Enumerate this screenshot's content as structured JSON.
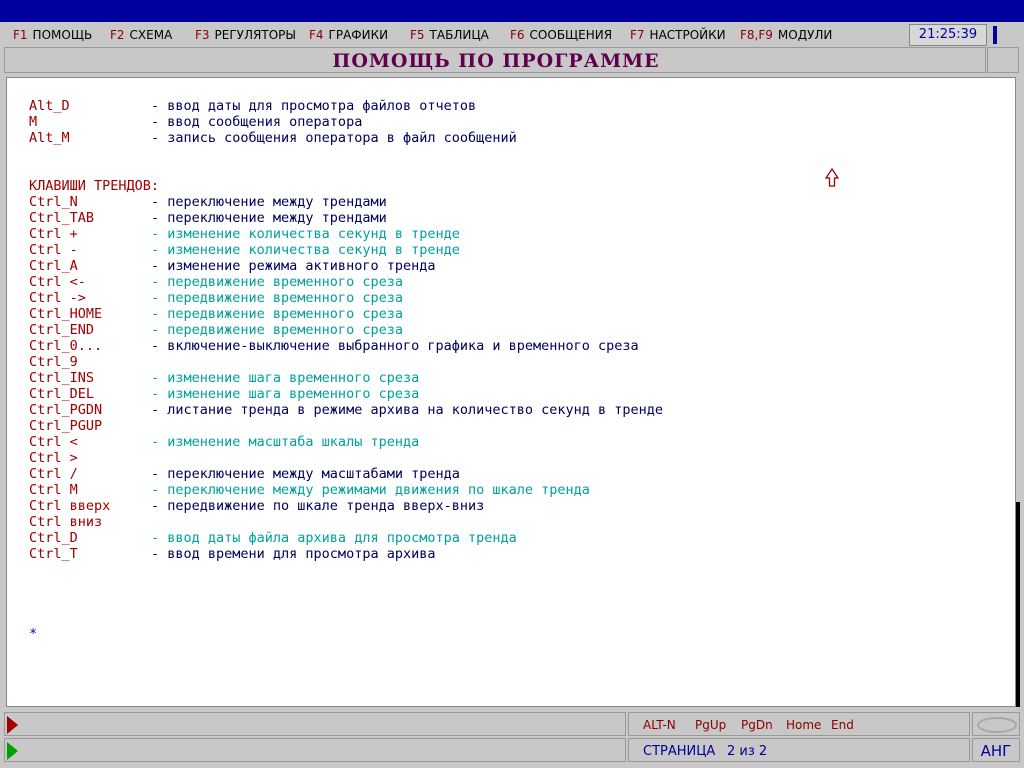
{
  "clock": "21:25:39",
  "menu": [
    {
      "key": "F1",
      "label": "ПОМОЩЬ"
    },
    {
      "key": "F2",
      "label": "СХЕМА"
    },
    {
      "key": "F3",
      "label": "РЕГУЛЯТОРЫ"
    },
    {
      "key": "F4",
      "label": "ГРАФИКИ"
    },
    {
      "key": "F5",
      "label": "ТАБЛИЦА"
    },
    {
      "key": "F6",
      "label": "СООБЩЕНИЯ"
    },
    {
      "key": "F7",
      "label": "НАСТРОЙКИ"
    },
    {
      "key": "F8,F9",
      "label": "МОДУЛИ"
    }
  ],
  "title": "ПОМОЩЬ  ПО  ПРОГРАММЕ",
  "lines": [
    {
      "key": "Alt_D",
      "desc": "- ввод даты для просмотра файлов отчетов",
      "style": "navy"
    },
    {
      "key": "M",
      "desc": "- ввод сообщения оператора",
      "style": "navy"
    },
    {
      "key": "Alt_M",
      "desc": "- запись сообщения оператора в файл сообщений",
      "style": "navy"
    },
    {
      "section": "КЛАВИШИ ТРЕНДОВ:"
    },
    {
      "key": "Ctrl_N",
      "desc": "- переключение между трендами",
      "style": "navy"
    },
    {
      "key": "Ctrl_TAB",
      "desc": "- переключение между трендами",
      "style": "navy"
    },
    {
      "key": "Ctrl +",
      "desc": "- изменение количества секунд в тренде",
      "style": "teal"
    },
    {
      "key": "Ctrl -",
      "desc": "- изменение количества секунд в тренде",
      "style": "teal"
    },
    {
      "key": "Ctrl_A",
      "desc": "- изменение режима активного тренда",
      "style": "navy"
    },
    {
      "key": "Ctrl <-",
      "desc": "- передвижение временного среза",
      "style": "teal"
    },
    {
      "key": "Ctrl ->",
      "desc": "- передвижение временного среза",
      "style": "teal"
    },
    {
      "key": "Ctrl_HOME",
      "desc": "- передвижение временного среза",
      "style": "teal"
    },
    {
      "key": "Ctrl_END",
      "desc": "- передвижение временного среза",
      "style": "teal"
    },
    {
      "key": "Ctrl_0...",
      "desc": "- включение-выключение выбранного графика и временного среза",
      "style": "navy"
    },
    {
      "key": "Ctrl_9",
      "desc": "",
      "style": "navy"
    },
    {
      "key": "Ctrl_INS",
      "desc": "- изменение шага временного среза",
      "style": "teal"
    },
    {
      "key": "Ctrl_DEL",
      "desc": "- изменение шага временного среза",
      "style": "teal"
    },
    {
      "key": "Ctrl_PGDN",
      "desc": "- листание тренда в режиме архива на количество секунд в тренде",
      "style": "navy"
    },
    {
      "key": "Ctrl_PGUP",
      "desc": "",
      "style": "navy"
    },
    {
      "key": "Ctrl <",
      "desc": "- изменение масштаба шкалы тренда",
      "style": "teal"
    },
    {
      "key": "Ctrl >",
      "desc": "",
      "style": "teal"
    },
    {
      "key": "Ctrl /",
      "desc": "- переключение между масштабами тренда",
      "style": "navy"
    },
    {
      "key": "Ctrl M",
      "desc": "- переключение между режимами движения по шкале тренда",
      "style": "teal"
    },
    {
      "key": "Ctrl вверх",
      "desc": "- передвижение по шкале тренда вверх-вниз",
      "style": "navy"
    },
    {
      "key": "Ctrl вниз",
      "desc": "",
      "style": "navy"
    },
    {
      "key": "Ctrl_D",
      "desc": "- ввод даты файла архива для просмотра тренда",
      "style": "teal"
    },
    {
      "key": "Ctrl_T",
      "desc": "- ввод времени для просмотра архива",
      "style": "navy"
    }
  ],
  "asterisk": "*",
  "softkeys": [
    "ALT-N",
    "PgUp",
    "PgDn",
    "Home",
    "End"
  ],
  "page_label": "СТРАНИЦА",
  "page_value": "2 из 2",
  "lang": "АНГ",
  "colors": {
    "navy": "#00005a",
    "teal": "#00a0a0",
    "key": "#a00000",
    "topbar": "#00009c"
  }
}
